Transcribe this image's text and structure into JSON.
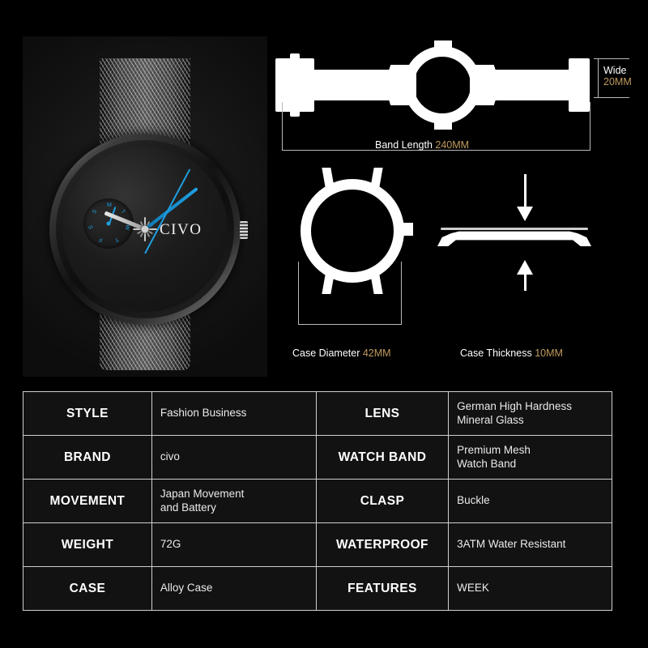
{
  "background_color": "#000000",
  "accent_gold": "#bf9a5d",
  "accent_blue": "#1f9fe0",
  "product": {
    "brand_on_dial": "CIVO",
    "subdial_letters": [
      "M",
      "T",
      "W",
      "T",
      "F",
      "S",
      "S"
    ]
  },
  "diagrams": {
    "band": {
      "dimension_label": "Band Length",
      "dimension_value": "240MM",
      "width_label": "Wide",
      "width_value": "20MM"
    },
    "case": {
      "dimension_label": "Case Diameter",
      "dimension_value": "42MM"
    },
    "thickness": {
      "dimension_label": "Case Thickness",
      "dimension_value": "10MM"
    }
  },
  "spec_table": {
    "rows": [
      {
        "left_key": "STYLE",
        "left_value": [
          "Fashion Business"
        ],
        "right_key": "LENS",
        "right_value": [
          "German High Hardness",
          "Mineral Glass"
        ]
      },
      {
        "left_key": "BRAND",
        "left_value": [
          "civo"
        ],
        "right_key": "WATCH BAND",
        "right_value": [
          "Premium Mesh",
          "Watch Band"
        ]
      },
      {
        "left_key": "MOVEMENT",
        "left_value": [
          "Japan Movement",
          "and Battery"
        ],
        "right_key": "CLASP",
        "right_value": [
          "Buckle"
        ]
      },
      {
        "left_key": "WEIGHT",
        "left_value": [
          "72G"
        ],
        "right_key": "WATERPROOF",
        "right_value": [
          "3ATM Water Resistant"
        ]
      },
      {
        "left_key": "CASE",
        "left_value": [
          "Alloy Case"
        ],
        "right_key": "FEATURES",
        "right_value": [
          "WEEK"
        ]
      }
    ]
  }
}
